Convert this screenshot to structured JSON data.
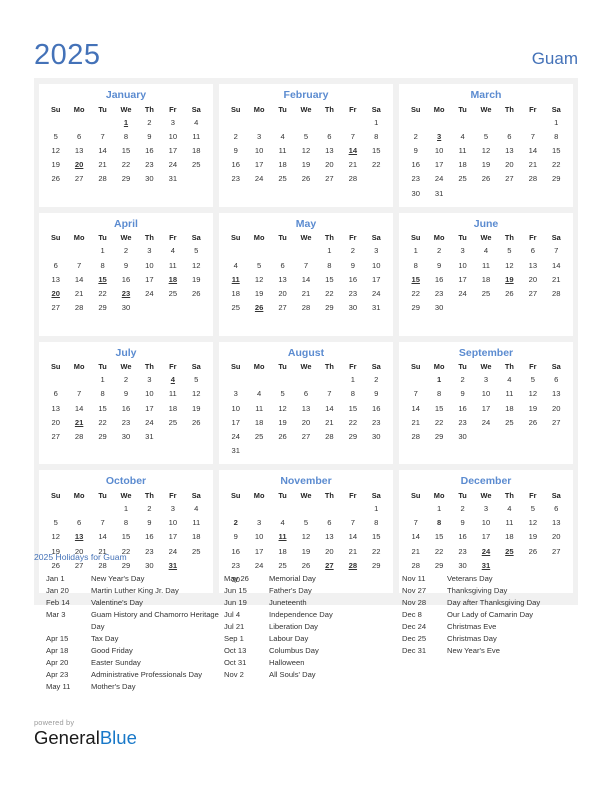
{
  "header": {
    "year": "2025",
    "country": "Guam"
  },
  "weekday_headers": [
    "Su",
    "Mo",
    "Tu",
    "We",
    "Th",
    "Fr",
    "Sa"
  ],
  "months": [
    {
      "name": "January",
      "weeks": [
        [
          "",
          "",
          "",
          "1",
          "2",
          "3",
          "4"
        ],
        [
          "5",
          "6",
          "7",
          "8",
          "9",
          "10",
          "11"
        ],
        [
          "12",
          "13",
          "14",
          "15",
          "16",
          "17",
          "18"
        ],
        [
          "19",
          "20",
          "21",
          "22",
          "23",
          "24",
          "25"
        ],
        [
          "26",
          "27",
          "28",
          "29",
          "30",
          "31",
          ""
        ],
        [
          "",
          "",
          "",
          "",
          "",
          "",
          ""
        ]
      ],
      "holidays": [
        "1",
        "20"
      ],
      "holidays_plain": []
    },
    {
      "name": "February",
      "weeks": [
        [
          "",
          "",
          "",
          "",
          "",
          "",
          "1"
        ],
        [
          "2",
          "3",
          "4",
          "5",
          "6",
          "7",
          "8"
        ],
        [
          "9",
          "10",
          "11",
          "12",
          "13",
          "14",
          "15"
        ],
        [
          "16",
          "17",
          "18",
          "19",
          "20",
          "21",
          "22"
        ],
        [
          "23",
          "24",
          "25",
          "26",
          "27",
          "28",
          ""
        ],
        [
          "",
          "",
          "",
          "",
          "",
          "",
          ""
        ]
      ],
      "holidays": [
        "14"
      ],
      "holidays_plain": []
    },
    {
      "name": "March",
      "weeks": [
        [
          "",
          "",
          "",
          "",
          "",
          "",
          "1"
        ],
        [
          "2",
          "3",
          "4",
          "5",
          "6",
          "7",
          "8"
        ],
        [
          "9",
          "10",
          "11",
          "12",
          "13",
          "14",
          "15"
        ],
        [
          "16",
          "17",
          "18",
          "19",
          "20",
          "21",
          "22"
        ],
        [
          "23",
          "24",
          "25",
          "26",
          "27",
          "28",
          "29"
        ],
        [
          "30",
          "31",
          "",
          "",
          "",
          "",
          ""
        ]
      ],
      "holidays": [
        "3"
      ],
      "holidays_plain": []
    },
    {
      "name": "April",
      "weeks": [
        [
          "",
          "",
          "1",
          "2",
          "3",
          "4",
          "5"
        ],
        [
          "6",
          "7",
          "8",
          "9",
          "10",
          "11",
          "12"
        ],
        [
          "13",
          "14",
          "15",
          "16",
          "17",
          "18",
          "19"
        ],
        [
          "20",
          "21",
          "22",
          "23",
          "24",
          "25",
          "26"
        ],
        [
          "27",
          "28",
          "29",
          "30",
          "",
          "",
          ""
        ],
        [
          "",
          "",
          "",
          "",
          "",
          "",
          ""
        ]
      ],
      "holidays": [
        "15",
        "18",
        "20",
        "23"
      ],
      "holidays_plain": []
    },
    {
      "name": "May",
      "weeks": [
        [
          "",
          "",
          "",
          "",
          "1",
          "2",
          "3"
        ],
        [
          "4",
          "5",
          "6",
          "7",
          "8",
          "9",
          "10"
        ],
        [
          "11",
          "12",
          "13",
          "14",
          "15",
          "16",
          "17"
        ],
        [
          "18",
          "19",
          "20",
          "21",
          "22",
          "23",
          "24"
        ],
        [
          "25",
          "26",
          "27",
          "28",
          "29",
          "30",
          "31"
        ],
        [
          "",
          "",
          "",
          "",
          "",
          "",
          ""
        ]
      ],
      "holidays": [
        "11",
        "26"
      ],
      "holidays_plain": []
    },
    {
      "name": "June",
      "weeks": [
        [
          "1",
          "2",
          "3",
          "4",
          "5",
          "6",
          "7"
        ],
        [
          "8",
          "9",
          "10",
          "11",
          "12",
          "13",
          "14"
        ],
        [
          "15",
          "16",
          "17",
          "18",
          "19",
          "20",
          "21"
        ],
        [
          "22",
          "23",
          "24",
          "25",
          "26",
          "27",
          "28"
        ],
        [
          "29",
          "30",
          "",
          "",
          "",
          "",
          ""
        ],
        [
          "",
          "",
          "",
          "",
          "",
          "",
          ""
        ]
      ],
      "holidays": [
        "15",
        "19"
      ],
      "holidays_plain": []
    },
    {
      "name": "July",
      "weeks": [
        [
          "",
          "",
          "1",
          "2",
          "3",
          "4",
          "5"
        ],
        [
          "6",
          "7",
          "8",
          "9",
          "10",
          "11",
          "12"
        ],
        [
          "13",
          "14",
          "15",
          "16",
          "17",
          "18",
          "19"
        ],
        [
          "20",
          "21",
          "22",
          "23",
          "24",
          "25",
          "26"
        ],
        [
          "27",
          "28",
          "29",
          "30",
          "31",
          "",
          ""
        ],
        [
          "",
          "",
          "",
          "",
          "",
          "",
          ""
        ]
      ],
      "holidays": [
        "4",
        "21"
      ],
      "holidays_plain": []
    },
    {
      "name": "August",
      "weeks": [
        [
          "",
          "",
          "",
          "",
          "",
          "1",
          "2"
        ],
        [
          "3",
          "4",
          "5",
          "6",
          "7",
          "8",
          "9"
        ],
        [
          "10",
          "11",
          "12",
          "13",
          "14",
          "15",
          "16"
        ],
        [
          "17",
          "18",
          "19",
          "20",
          "21",
          "22",
          "23"
        ],
        [
          "24",
          "25",
          "26",
          "27",
          "28",
          "29",
          "30"
        ],
        [
          "31",
          "",
          "",
          "",
          "",
          "",
          ""
        ]
      ],
      "holidays": [],
      "holidays_plain": []
    },
    {
      "name": "September",
      "weeks": [
        [
          "",
          "1",
          "2",
          "3",
          "4",
          "5",
          "6"
        ],
        [
          "7",
          "8",
          "9",
          "10",
          "11",
          "12",
          "13"
        ],
        [
          "14",
          "15",
          "16",
          "17",
          "18",
          "19",
          "20"
        ],
        [
          "21",
          "22",
          "23",
          "24",
          "25",
          "26",
          "27"
        ],
        [
          "28",
          "29",
          "30",
          "",
          "",
          "",
          ""
        ],
        [
          "",
          "",
          "",
          "",
          "",
          "",
          ""
        ]
      ],
      "holidays": [],
      "holidays_plain": [
        "1"
      ]
    },
    {
      "name": "October",
      "weeks": [
        [
          "",
          "",
          "",
          "1",
          "2",
          "3",
          "4"
        ],
        [
          "5",
          "6",
          "7",
          "8",
          "9",
          "10",
          "11"
        ],
        [
          "12",
          "13",
          "14",
          "15",
          "16",
          "17",
          "18"
        ],
        [
          "19",
          "20",
          "21",
          "22",
          "23",
          "24",
          "25"
        ],
        [
          "26",
          "27",
          "28",
          "29",
          "30",
          "31",
          ""
        ],
        [
          "",
          "",
          "",
          "",
          "",
          "",
          ""
        ]
      ],
      "holidays": [
        "13",
        "31"
      ],
      "holidays_plain": []
    },
    {
      "name": "November",
      "weeks": [
        [
          "",
          "",
          "",
          "",
          "",
          "",
          "1"
        ],
        [
          "2",
          "3",
          "4",
          "5",
          "6",
          "7",
          "8"
        ],
        [
          "9",
          "10",
          "11",
          "12",
          "13",
          "14",
          "15"
        ],
        [
          "16",
          "17",
          "18",
          "19",
          "20",
          "21",
          "22"
        ],
        [
          "23",
          "24",
          "25",
          "26",
          "27",
          "28",
          "29"
        ],
        [
          "30",
          "",
          "",
          "",
          "",
          "",
          ""
        ]
      ],
      "holidays": [
        "11",
        "27",
        "28"
      ],
      "holidays_plain": [
        "2"
      ]
    },
    {
      "name": "December",
      "weeks": [
        [
          "",
          "1",
          "2",
          "3",
          "4",
          "5",
          "6"
        ],
        [
          "7",
          "8",
          "9",
          "10",
          "11",
          "12",
          "13"
        ],
        [
          "14",
          "15",
          "16",
          "17",
          "18",
          "19",
          "20"
        ],
        [
          "21",
          "22",
          "23",
          "24",
          "25",
          "26",
          "27"
        ],
        [
          "28",
          "29",
          "30",
          "31",
          "",
          "",
          ""
        ],
        [
          "",
          "",
          "",
          "",
          "",
          "",
          ""
        ]
      ],
      "holidays": [
        "24",
        "25",
        "31"
      ],
      "holidays_plain": [
        "8"
      ]
    }
  ],
  "holidays_section": {
    "title": "2025 Holidays for Guam",
    "columns": [
      [
        {
          "date": "Jan 1",
          "name": "New Year's Day"
        },
        {
          "date": "Jan 20",
          "name": "Martin Luther King Jr. Day"
        },
        {
          "date": "Feb 14",
          "name": "Valentine's Day"
        },
        {
          "date": "Mar 3",
          "name": "Guam History and Chamorro Heritage Day"
        },
        {
          "date": "Apr 15",
          "name": "Tax Day"
        },
        {
          "date": "Apr 18",
          "name": "Good Friday"
        },
        {
          "date": "Apr 20",
          "name": "Easter Sunday"
        },
        {
          "date": "Apr 23",
          "name": "Administrative Professionals Day"
        },
        {
          "date": "May 11",
          "name": "Mother's Day"
        }
      ],
      [
        {
          "date": "May 26",
          "name": "Memorial Day"
        },
        {
          "date": "Jun 15",
          "name": "Father's Day"
        },
        {
          "date": "Jun 19",
          "name": "Juneteenth"
        },
        {
          "date": "Jul 4",
          "name": "Independence Day"
        },
        {
          "date": "Jul 21",
          "name": "Liberation Day"
        },
        {
          "date": "Sep 1",
          "name": "Labour Day"
        },
        {
          "date": "Oct 13",
          "name": "Columbus Day"
        },
        {
          "date": "Oct 31",
          "name": "Halloween"
        },
        {
          "date": "Nov 2",
          "name": "All Souls' Day"
        }
      ],
      [
        {
          "date": "Nov 11",
          "name": "Veterans Day"
        },
        {
          "date": "Nov 27",
          "name": "Thanksgiving Day"
        },
        {
          "date": "Nov 28",
          "name": "Day after Thanksgiving Day"
        },
        {
          "date": "Dec 8",
          "name": "Our Lady of Camarin Day"
        },
        {
          "date": "Dec 24",
          "name": "Christmas Eve"
        },
        {
          "date": "Dec 25",
          "name": "Christmas Day"
        },
        {
          "date": "Dec 31",
          "name": "New Year's Eve"
        }
      ]
    ]
  },
  "footer": {
    "powered_by": "powered by",
    "brand_first": "General",
    "brand_second": "Blue"
  },
  "colors": {
    "accent_blue": "#4472b8",
    "month_blue": "#5b8bd0",
    "holiday_red": "#e00000",
    "container_gray": "#f1f1f1",
    "brand_blue": "#1878c8"
  }
}
